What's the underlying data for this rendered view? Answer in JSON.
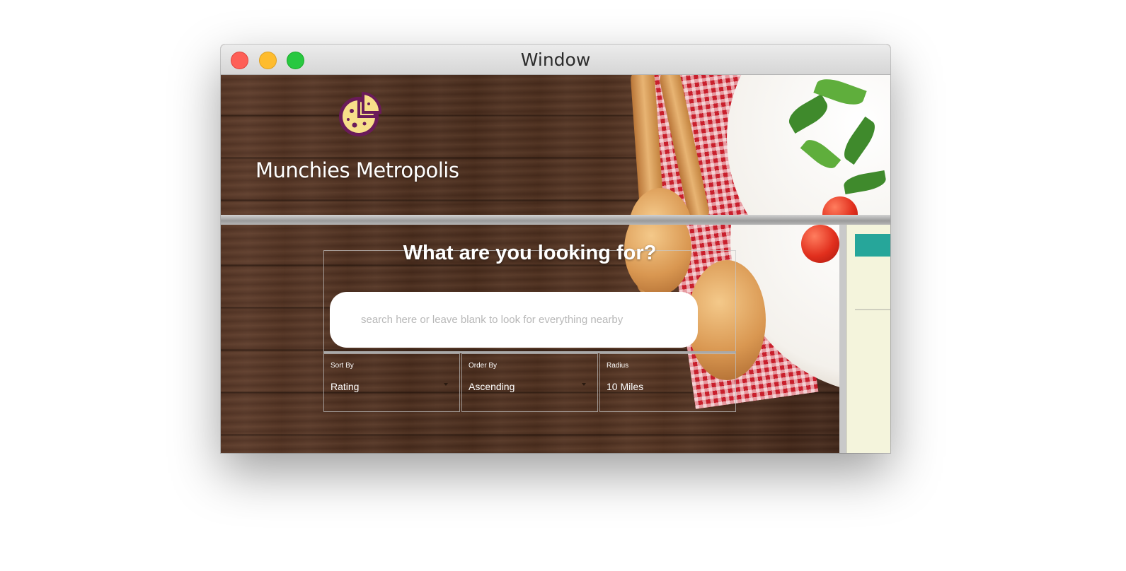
{
  "window": {
    "title": "Window"
  },
  "header": {
    "brand": "Munchies Metropolis",
    "logo_icon": "pizza-icon"
  },
  "search": {
    "heading": "What are you looking for?",
    "placeholder": "search here or leave blank to look for everything nearby",
    "value": ""
  },
  "filters": [
    {
      "label": "Sort By",
      "value": "Rating"
    },
    {
      "label": "Order By",
      "value": "Ascending"
    },
    {
      "label": "Radius",
      "value": "10 Miles"
    }
  ],
  "colors": {
    "accent": "#26a69a",
    "side_panel": "#f4f4dc",
    "logo_ring": "#6a1b5a",
    "logo_fill": "#f7e08a"
  }
}
